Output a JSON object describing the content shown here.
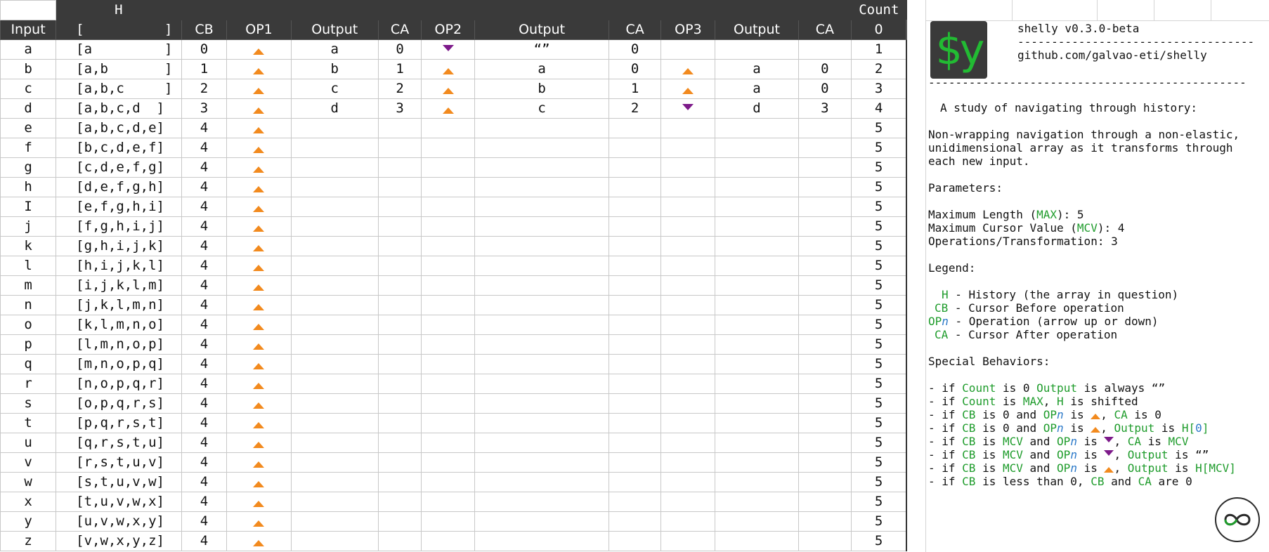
{
  "sheet": {
    "top_h": "H",
    "top_count": "Count",
    "headers": {
      "input": "Input",
      "h": "[          ]",
      "cb": "CB",
      "op1": "OP1",
      "out1": "Output",
      "ca1": "CA",
      "op2": "OP2",
      "out2": "Output",
      "ca2": "CA",
      "op3": "OP3",
      "out3": "Output",
      "ca3": "CA",
      "count": "0"
    },
    "rows": [
      {
        "input": "a",
        "h": "[a         ]",
        "cb": "0",
        "op1": "up",
        "out1": "a",
        "ca1": "0",
        "op2": "down",
        "out2": "“”",
        "ca2": "0",
        "op3": "",
        "out3": "",
        "ca3": "",
        "count": "1"
      },
      {
        "input": "b",
        "h": "[a,b       ]",
        "cb": "1",
        "op1": "up",
        "out1": "b",
        "ca1": "1",
        "op2": "up",
        "out2": "a",
        "ca2": "0",
        "op3": "up",
        "out3": "a",
        "ca3": "0",
        "count": "2"
      },
      {
        "input": "c",
        "h": "[a,b,c     ]",
        "cb": "2",
        "op1": "up",
        "out1": "c",
        "ca1": "2",
        "op2": "up",
        "out2": "b",
        "ca2": "1",
        "op3": "up",
        "out3": "a",
        "ca3": "0",
        "count": "3"
      },
      {
        "input": "d",
        "h": "[a,b,c,d  ]",
        "cb": "3",
        "op1": "up",
        "out1": "d",
        "ca1": "3",
        "op2": "up",
        "out2": "c",
        "ca2": "2",
        "op3": "down",
        "out3": "d",
        "ca3": "3",
        "count": "4"
      },
      {
        "input": "e",
        "h": "[a,b,c,d,e]",
        "cb": "4",
        "op1": "up",
        "count": "5"
      },
      {
        "input": "f",
        "h": "[b,c,d,e,f]",
        "cb": "4",
        "op1": "up",
        "count": "5"
      },
      {
        "input": "g",
        "h": "[c,d,e,f,g]",
        "cb": "4",
        "op1": "up",
        "count": "5"
      },
      {
        "input": "h",
        "h": "[d,e,f,g,h]",
        "cb": "4",
        "op1": "up",
        "count": "5"
      },
      {
        "input": "I",
        "h": "[e,f,g,h,i]",
        "cb": "4",
        "op1": "up",
        "count": "5"
      },
      {
        "input": "j",
        "h": "[f,g,h,i,j]",
        "cb": "4",
        "op1": "up",
        "count": "5"
      },
      {
        "input": "k",
        "h": "[g,h,i,j,k]",
        "cb": "4",
        "op1": "up",
        "count": "5"
      },
      {
        "input": "l",
        "h": "[h,i,j,k,l]",
        "cb": "4",
        "op1": "up",
        "count": "5"
      },
      {
        "input": "m",
        "h": "[i,j,k,l,m]",
        "cb": "4",
        "op1": "up",
        "count": "5"
      },
      {
        "input": "n",
        "h": "[j,k,l,m,n]",
        "cb": "4",
        "op1": "up",
        "count": "5"
      },
      {
        "input": "o",
        "h": "[k,l,m,n,o]",
        "cb": "4",
        "op1": "up",
        "count": "5"
      },
      {
        "input": "p",
        "h": "[l,m,n,o,p]",
        "cb": "4",
        "op1": "up",
        "count": "5"
      },
      {
        "input": "q",
        "h": "[m,n,o,p,q]",
        "cb": "4",
        "op1": "up",
        "count": "5"
      },
      {
        "input": "r",
        "h": "[n,o,p,q,r]",
        "cb": "4",
        "op1": "up",
        "count": "5"
      },
      {
        "input": "s",
        "h": "[o,p,q,r,s]",
        "cb": "4",
        "op1": "up",
        "count": "5"
      },
      {
        "input": "t",
        "h": "[p,q,r,s,t]",
        "cb": "4",
        "op1": "up",
        "count": "5"
      },
      {
        "input": "u",
        "h": "[q,r,s,t,u]",
        "cb": "4",
        "op1": "up",
        "count": "5"
      },
      {
        "input": "v",
        "h": "[r,s,t,u,v]",
        "cb": "4",
        "op1": "up",
        "count": "5"
      },
      {
        "input": "w",
        "h": "[s,t,u,v,w]",
        "cb": "4",
        "op1": "up",
        "count": "5"
      },
      {
        "input": "x",
        "h": "[t,u,v,w,x]",
        "cb": "4",
        "op1": "up",
        "count": "5"
      },
      {
        "input": "y",
        "h": "[u,v,w,x,y]",
        "cb": "4",
        "op1": "up",
        "count": "5"
      },
      {
        "input": "z",
        "h": "[v,w,x,y,z]",
        "cb": "4",
        "op1": "up",
        "count": "5"
      }
    ]
  },
  "panel": {
    "logo_text": "$y",
    "title": "shelly v0.3.0-beta",
    "dashes_short": "-----------------------------------",
    "url": "github.com/galvao-eti/shelly",
    "dashes_long": "-----------------------------------------------",
    "study": "A study of navigating through history:",
    "desc_1": "Non-wrapping navigation through a non-elastic,",
    "desc_2": "unidimensional array as it transforms through",
    "desc_3": "each new input.",
    "params_title": "Parameters:",
    "param_max_a": "Maximum Length (",
    "param_max_k": "MAX",
    "param_max_b": "): 5",
    "param_mcv_a": "Maximum Cursor Value (",
    "param_mcv_k": "MCV",
    "param_mcv_b": "): 4",
    "param_ops": "Operations/Transformation: 3",
    "legend_title": "Legend:",
    "leg_h_k": "H",
    "leg_h_t": " - History (the array in question)",
    "leg_cb_k": "CB",
    "leg_cb_t": " - Cursor Before operation",
    "leg_op_k": "OP",
    "leg_op_n": "n",
    "leg_op_t": " - Operation (arrow up or down)",
    "leg_ca_k": "CA",
    "leg_ca_t": " - Cursor After operation",
    "special_title": "Special Behaviors:",
    "w_if": "- if ",
    "w_is": " is ",
    "w_and": " and ",
    "w_comma": ", ",
    "w_always": " is always “”",
    "w_shifted": " is shifted",
    "w_lt0": " is less than 0, ",
    "w_are0": " are 0",
    "k_count": "Count",
    "k_output": "Output",
    "k_max": "MAX",
    "k_h": "H",
    "k_cb": "CB",
    "k_ca": "CA",
    "k_opn_a": "OP",
    "k_opn_b": "n",
    "k_mcv": "MCV",
    "v_0": "0",
    "v_empty": "“”",
    "v_h0a": "H[",
    "v_h0b": "0",
    "v_h0c": "]",
    "v_hmcv_a": "H[",
    "v_hmcv_b": "MCV",
    "v_hmcv_c": "]"
  },
  "colors": {
    "header_bg": "#3a3a3a",
    "arrow_up": "#f28a1e",
    "arrow_down": "#7d1a8a",
    "keyword_green": "#1f9c2c",
    "keyword_blue": "#2a78c8"
  }
}
